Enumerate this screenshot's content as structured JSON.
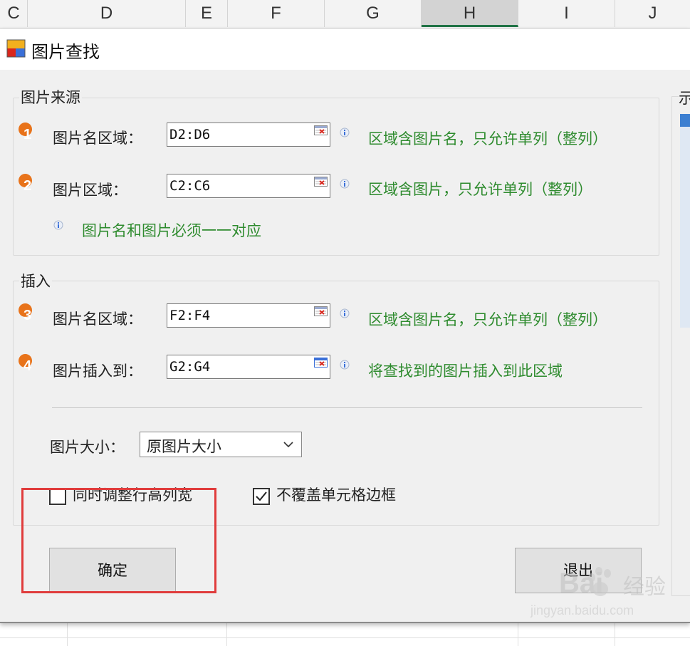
{
  "sheet": {
    "columns": [
      "C",
      "D",
      "E",
      "F",
      "G",
      "H",
      "I",
      "J"
    ],
    "selected_column": "H"
  },
  "dialog": {
    "title": "图片查找",
    "source_group": {
      "legend": "图片来源",
      "rows": [
        {
          "num": "1",
          "label": "图片名区域：",
          "value": "D2:D6",
          "hint": "区域含图片名，只允许单列（整列）"
        },
        {
          "num": "2",
          "label": "图片区域：",
          "value": "C2:C6",
          "hint": "区域含图片，只允许单列（整列）"
        }
      ],
      "note": "图片名和图片必须一一对应"
    },
    "insert_group": {
      "legend": "插入",
      "rows": [
        {
          "num": "3",
          "label": "图片名区域：",
          "value": "F2:F4",
          "hint": "区域含图片名，只允许单列（整列）"
        },
        {
          "num": "4",
          "label": "图片插入到：",
          "value": "G2:G4",
          "hint": "将查找到的图片插入到此区域"
        }
      ],
      "size_label": "图片大小：",
      "size_value": "原图片大小",
      "check_adjust_label": "同时调整行高列宽",
      "check_adjust_checked": false,
      "check_border_label": "不覆盖单元格边框",
      "check_border_checked": true
    },
    "ok_label": "确定",
    "exit_label": "退出",
    "preview_label": "示"
  },
  "watermark": {
    "brand": "Bai",
    "brand_cn": "经验",
    "url": "jingyan.baidu.com"
  },
  "colors": {
    "hint_green": "#2e8b2e",
    "badge_orange": "#e8731a",
    "highlight_red": "#e03c3c",
    "excel_green": "#217346"
  }
}
